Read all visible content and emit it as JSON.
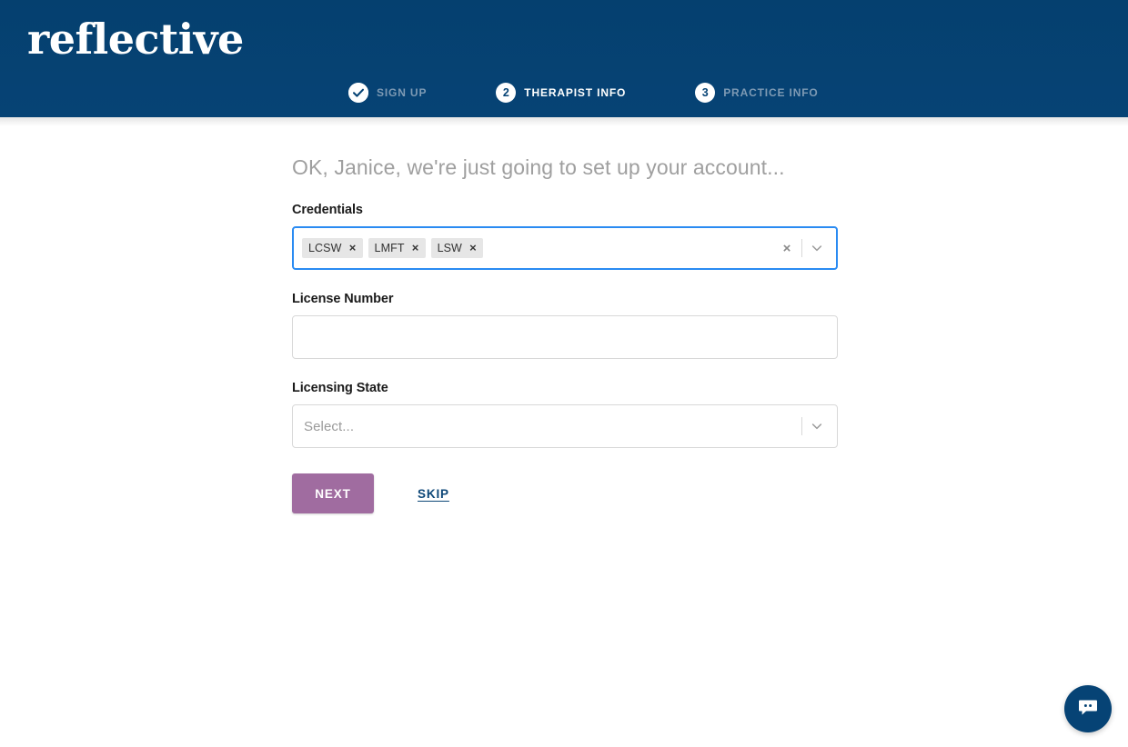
{
  "brand": {
    "logo_text": "reflective",
    "header_color": "#064375",
    "accent_button_color": "#a06ca0",
    "focus_border_color": "#2a8bf2"
  },
  "stepper": {
    "steps": [
      {
        "marker": "check",
        "number": "",
        "label": "SIGN UP",
        "state": "done"
      },
      {
        "marker": "number",
        "number": "2",
        "label": "THERAPIST INFO",
        "state": "active"
      },
      {
        "marker": "number",
        "number": "3",
        "label": "PRACTICE INFO",
        "state": "todo"
      }
    ]
  },
  "main": {
    "headline": "OK, Janice, we're just going to set up your account...",
    "fields": {
      "credentials": {
        "label": "Credentials",
        "tags": [
          {
            "label": "LCSW",
            "remove": "×"
          },
          {
            "label": "LMFT",
            "remove": "×"
          },
          {
            "label": "LSW",
            "remove": "×"
          }
        ],
        "clear_all": "×"
      },
      "license_number": {
        "label": "License Number",
        "value": "",
        "placeholder": ""
      },
      "licensing_state": {
        "label": "Licensing State",
        "placeholder": "Select..."
      }
    },
    "actions": {
      "next_label": "Next",
      "skip_label": "Skip"
    }
  },
  "chat": {
    "icon": "chat-bubble-icon"
  }
}
